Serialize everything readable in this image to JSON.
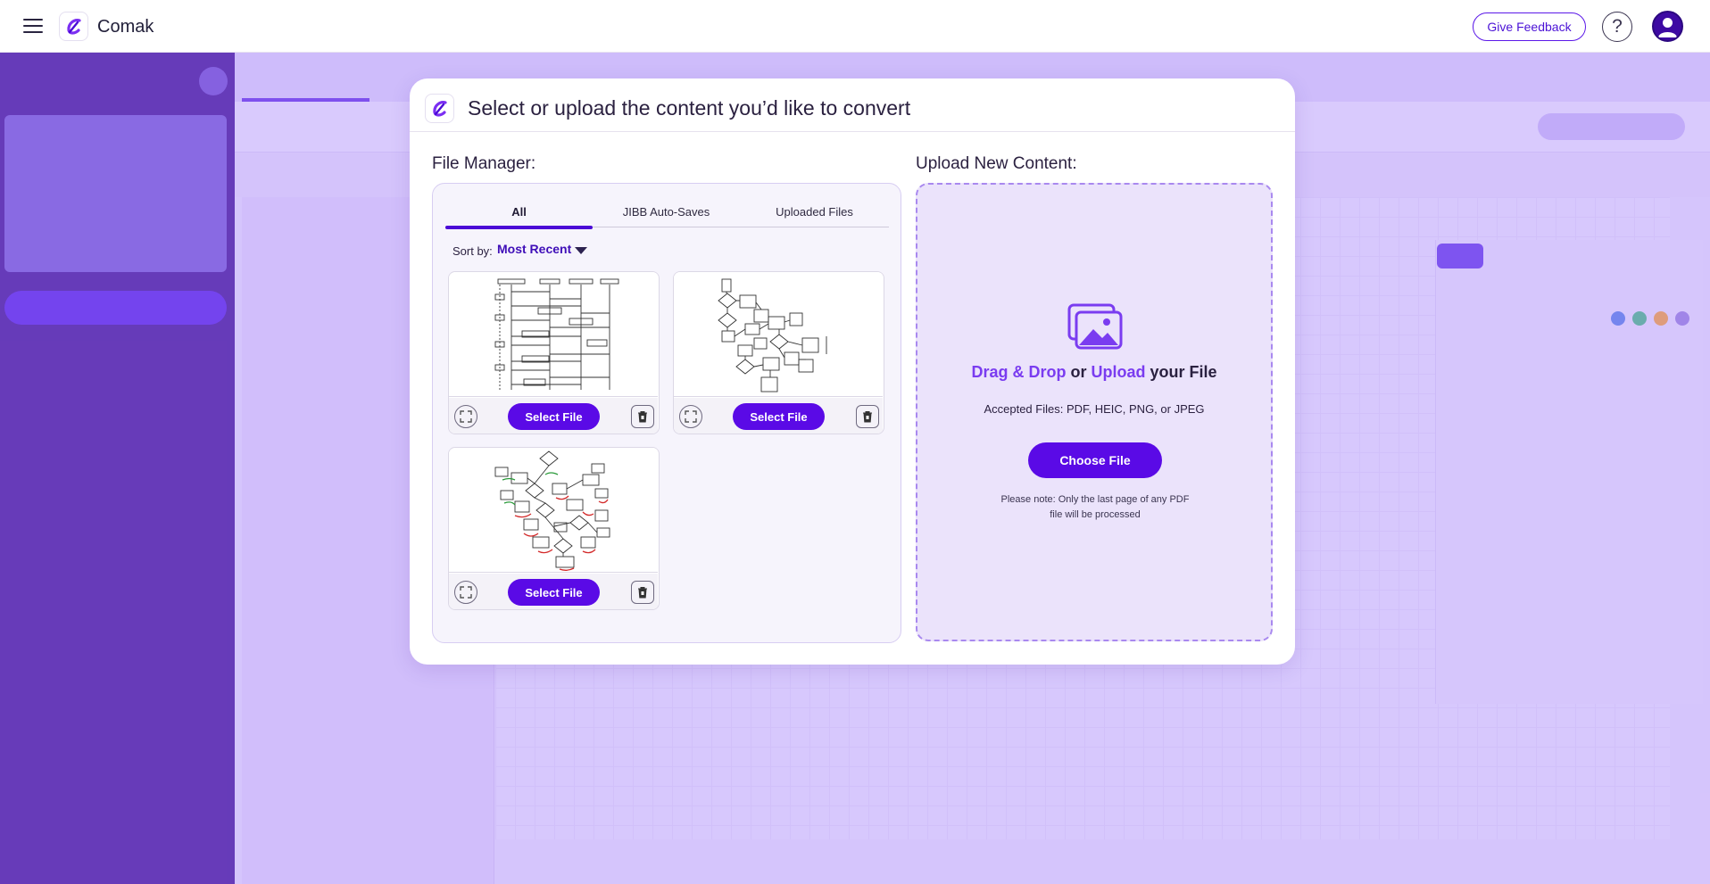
{
  "app": {
    "name": "Comak"
  },
  "header": {
    "feedback_label": "Give Feedback",
    "help_glyph": "?"
  },
  "modal": {
    "title": "Select or upload the content you’d like to convert",
    "file_manager": {
      "label": "File Manager:",
      "tabs": [
        {
          "label": "All",
          "active": true
        },
        {
          "label": "JIBB Auto-Saves",
          "active": false
        },
        {
          "label": "Uploaded Files",
          "active": false
        }
      ],
      "sort_label": "Sort by:",
      "sort_value": "Most Recent",
      "files": [
        {
          "thumbnail": "sequence-diagram-sketch",
          "select_label": "Select File",
          "expand_icon": "expand-icon",
          "delete_icon": "trash-icon"
        },
        {
          "thumbnail": "flowchart-sketch",
          "select_label": "Select File",
          "expand_icon": "expand-icon",
          "delete_icon": "trash-icon"
        },
        {
          "thumbnail": "colored-flowchart-sketch",
          "select_label": "Select File",
          "expand_icon": "expand-icon",
          "delete_icon": "trash-icon"
        }
      ]
    },
    "upload": {
      "label": "Upload New Content:",
      "dd_part1": "Drag & Drop",
      "dd_part2": " or ",
      "dd_part3": "Upload",
      "dd_part4": " your File",
      "accepted": "Accepted Files: PDF, HEIC, PNG, or JPEG",
      "choose_label": "Choose File",
      "note": "Please note: Only the last page of any PDF file will be processed"
    }
  },
  "colors": {
    "brand": "#5a0ae6",
    "sidebar": "#3a039e",
    "accent_text": "#7a3cf0",
    "upload_bg": "#ebe3fb"
  }
}
